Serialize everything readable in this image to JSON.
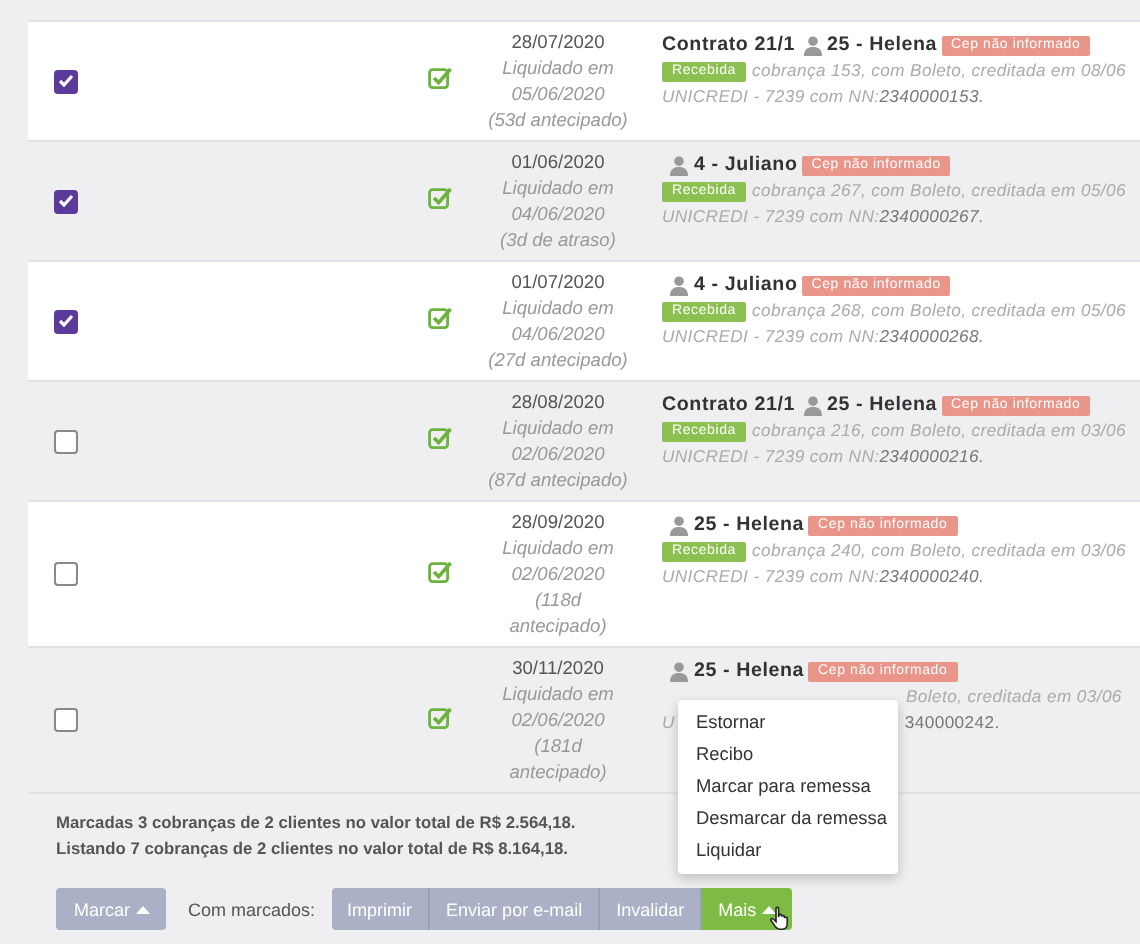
{
  "rows": [
    {
      "kind": "full",
      "checked": true,
      "settled": true,
      "due": "28/07/2020",
      "settled_label": "Liquidado em",
      "settled_date": "05/06/2020",
      "note": "(53d antecipado)",
      "contract": "Contrato 21/1",
      "client": "25 - Helena",
      "tag": "Cep não informado",
      "status": "Recebida",
      "detail": "cobrança 153, com Boleto, creditada em 08/06",
      "bank": "UNICREDI - 7239 com NN:**2340000153.**"
    },
    {
      "kind": "full",
      "checked": true,
      "settled": true,
      "due": "01/06/2020",
      "settled_label": "Liquidado em",
      "settled_date": "04/06/2020",
      "note": "(3d de atraso)",
      "client": "4 - Juliano",
      "tag": "Cep não informado",
      "status": "Recebida",
      "detail": "cobrança 267, com Boleto, creditada em 05/06",
      "bank": "UNICREDI - 7239 com NN:**2340000267.**"
    },
    {
      "kind": "full",
      "checked": true,
      "settled": true,
      "due": "01/07/2020",
      "settled_label": "Liquidado em",
      "settled_date": "04/06/2020",
      "note": "(27d antecipado)",
      "client": "4 - Juliano",
      "tag": "Cep não informado",
      "status": "Recebida",
      "detail": "cobrança 268, com Boleto, creditada em 05/06",
      "bank": "UNICREDI - 7239 com NN:**2340000268.**"
    },
    {
      "kind": "full",
      "checked": false,
      "settled": true,
      "due": "28/08/2020",
      "settled_label": "Liquidado em",
      "settled_date": "02/06/2020",
      "note": "(87d antecipado)",
      "contract": "Contrato 21/1",
      "client": "25 - Helena",
      "tag": "Cep não informado",
      "status": "Recebida",
      "detail": "cobrança 216, com Boleto, creditada em 03/06",
      "bank": "UNICREDI - 7239 com NN:**2340000216.**"
    },
    {
      "kind": "full",
      "checked": false,
      "settled": true,
      "due": "28/09/2020",
      "settled_label": "Liquidado em",
      "settled_date": "02/06/2020",
      "note": "(118d antecipado)",
      "client": "25 - Helena",
      "tag": "Cep não informado",
      "status": "Recebida",
      "detail": "cobrança 240, com Boleto, creditada em 03/06",
      "bank": "UNICREDI - 7239 com NN:**2340000240.**"
    },
    {
      "kind": "covered",
      "checked": false,
      "settled": true,
      "due": "30/11/2020",
      "settled_label": "Liquidado em",
      "settled_date": "02/06/2020",
      "note": "(181d antecipado)",
      "client": "25 - Helena",
      "tag": "Cep não informado",
      "detail": "Boleto, creditada em 03/06",
      "bank_start": "U",
      "bank_end": "340000242."
    }
  ],
  "summary": [
    "Marcadas 3 cobranças de 2 clientes no valor total de R$ 2.564,18.",
    "Listando 7 cobranças de 2 clientes no valor total de R$ 8.164,18."
  ],
  "mark_button": "Marcar",
  "with_marked": "Com marcados:",
  "actions": [
    {
      "label": "Imprimir",
      "kind": "plain"
    },
    {
      "label": "Enviar por e-mail",
      "kind": "plain"
    },
    {
      "label": "Invalidar",
      "kind": "plain"
    },
    {
      "label": "Mais",
      "kind": "more"
    }
  ],
  "menu": [
    "Estornar",
    "Recibo",
    "Marcar para remessa",
    "Desmarcar da remessa",
    "Liquidar"
  ]
}
